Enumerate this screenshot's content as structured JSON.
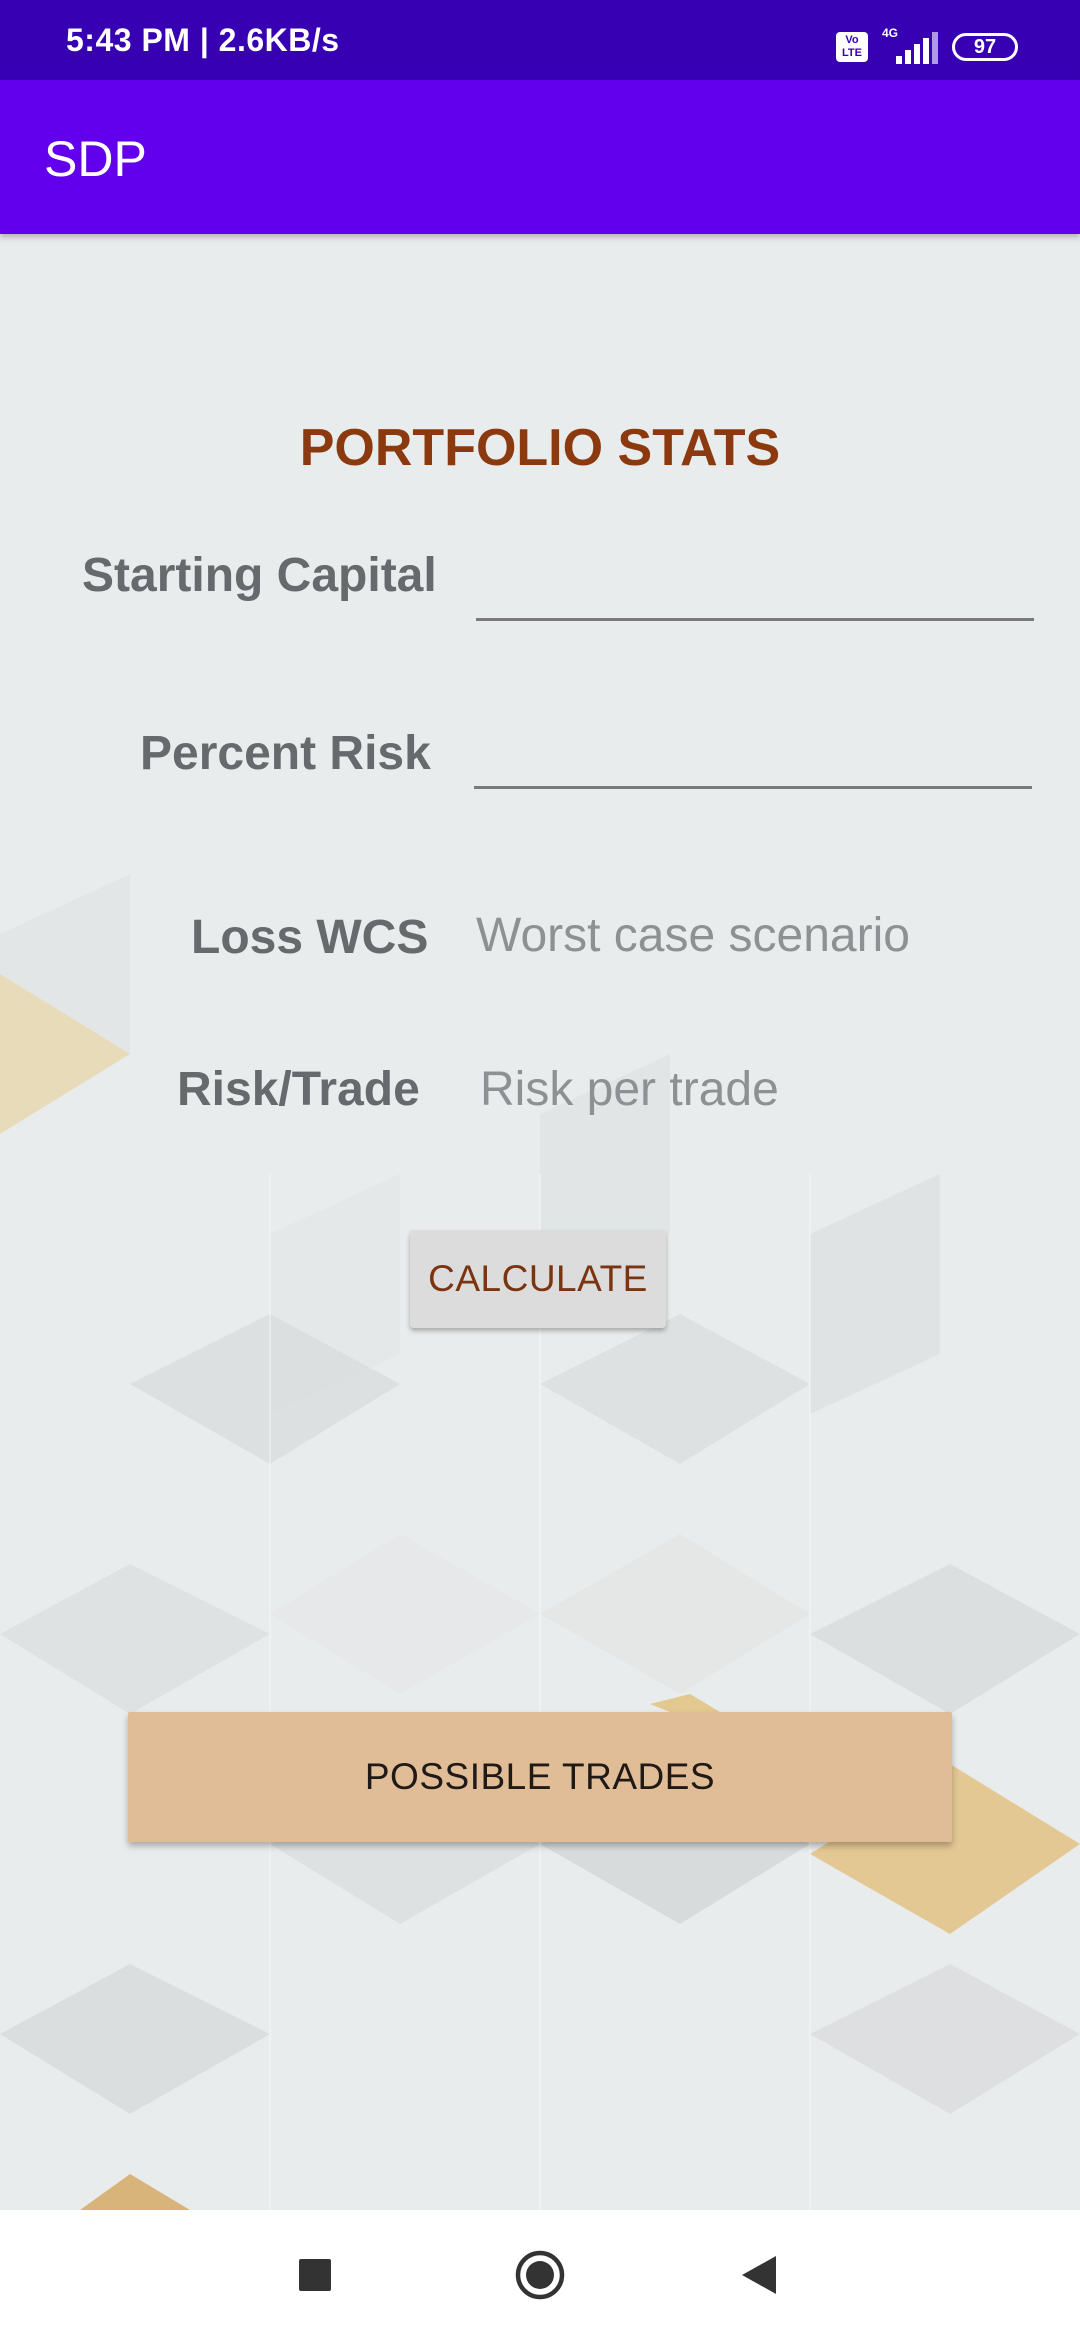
{
  "status_bar": {
    "time_speed": "5:43 PM | 2.6KB/s",
    "volte_label": "Vo LTE",
    "network_type": "4G",
    "battery_level": "97"
  },
  "app_bar": {
    "title": "SDP"
  },
  "form": {
    "section_title": "PORTFOLIO STATS",
    "starting_capital_label": "Starting Capital",
    "starting_capital_value": "",
    "percent_risk_label": "Percent Risk",
    "percent_risk_value": "",
    "loss_wcs_label": "Loss WCS",
    "loss_wcs_text": "Worst case scenario",
    "risk_trade_label": "Risk/Trade",
    "risk_trade_text": "Risk per trade",
    "calculate_label": "CALCULATE",
    "possible_trades_label": "POSSIBLE TRADES"
  },
  "nav_bar": {
    "icons": [
      "recents-square-icon",
      "home-circle-icon",
      "back-triangle-icon"
    ]
  },
  "colors": {
    "status_bar": "#3700b3",
    "app_bar": "#6200ee",
    "section_title": "#8b3a0f",
    "label": "#666a6c",
    "calculate_button": "#dcdcdc",
    "possible_trades_button": "#e0bd96"
  }
}
